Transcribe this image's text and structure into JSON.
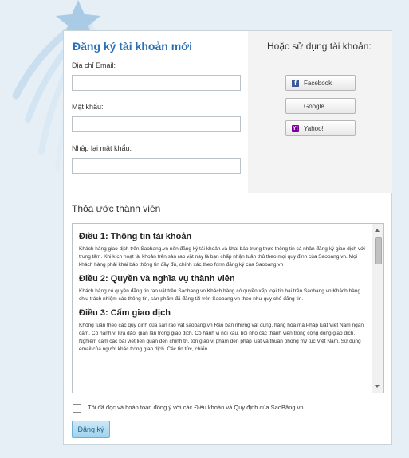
{
  "register": {
    "title": "Đăng ký tài khoản mới",
    "email_label": "Địa chỉ Email:",
    "password_label": "Mật khẩu:",
    "confirm_label": "Nhập lại mật khẩu:",
    "submit_label": "Đăng ký"
  },
  "social": {
    "title": "Hoặc sử dụng tài khoản:",
    "buttons": [
      {
        "label": "Facebook",
        "icon": "facebook-icon"
      },
      {
        "label": "Google",
        "icon": "google-icon"
      },
      {
        "label": "Yahoo!",
        "icon": "yahoo-icon"
      }
    ]
  },
  "terms": {
    "heading": "Thỏa ước thành viên",
    "articles": [
      {
        "title": "Điều 1: Thông tin tài khoản",
        "text": "Khách hàng giao dịch trên Saobang.vn nên đăng ký tài khoản và khai báo trung thực thông tin cá nhân đăng ký giao dịch với trung tâm. Khi kích hoạt tài khoản trên sàn rao vặt này là bạn chấp nhận tuân thủ theo mọi quy định của Saobang.vn. Mọi khách hàng phải khai báo thông tin đầy đủ, chính xác theo form đăng ký của Saobang.vn"
      },
      {
        "title": "Điều 2: Quyền và nghĩa vụ thành viên",
        "text": "Khách hàng có quyền đăng tin rao vặt trên Saobang.vn Khách hàng có quyền xếp loại tin bài trên Saobang.vn Khách hàng chịu trách nhiệm các thông tin, sản phẩm đã đăng tải trên Saobang.vn theo như quy chế đăng tin."
      },
      {
        "title": "Điều 3: Cấm giao dịch",
        "text": "Không tuân theo các quy định của sàn rao vặt saobang.vn Rao bán những vật dụng, hàng hóa mà Pháp luật Việt Nam ngăn cấm. Có hành vi lừa đảo, gian lận trong giao dịch. Có hành vi nói xấu, bôi nhọ các thành viên trong cộng đồng giao dịch. Nghiêm cấm các bài viết liên quan đến chính trị, tôn giáo vi phạm đến pháp luật và thuần phong mỹ tục Việt Nam. Sử dụng email của người khác trong giao dịch. Các tin tức, chiến"
      }
    ],
    "agree_label": "Tôi đã đọc và hoàn toàn đồng ý với các Điều khoản và Quy định của SaoBăng.vn"
  },
  "colors": {
    "background": "#e6eff5",
    "title_blue": "#2a6fb5",
    "star": "#a9cbe6"
  }
}
